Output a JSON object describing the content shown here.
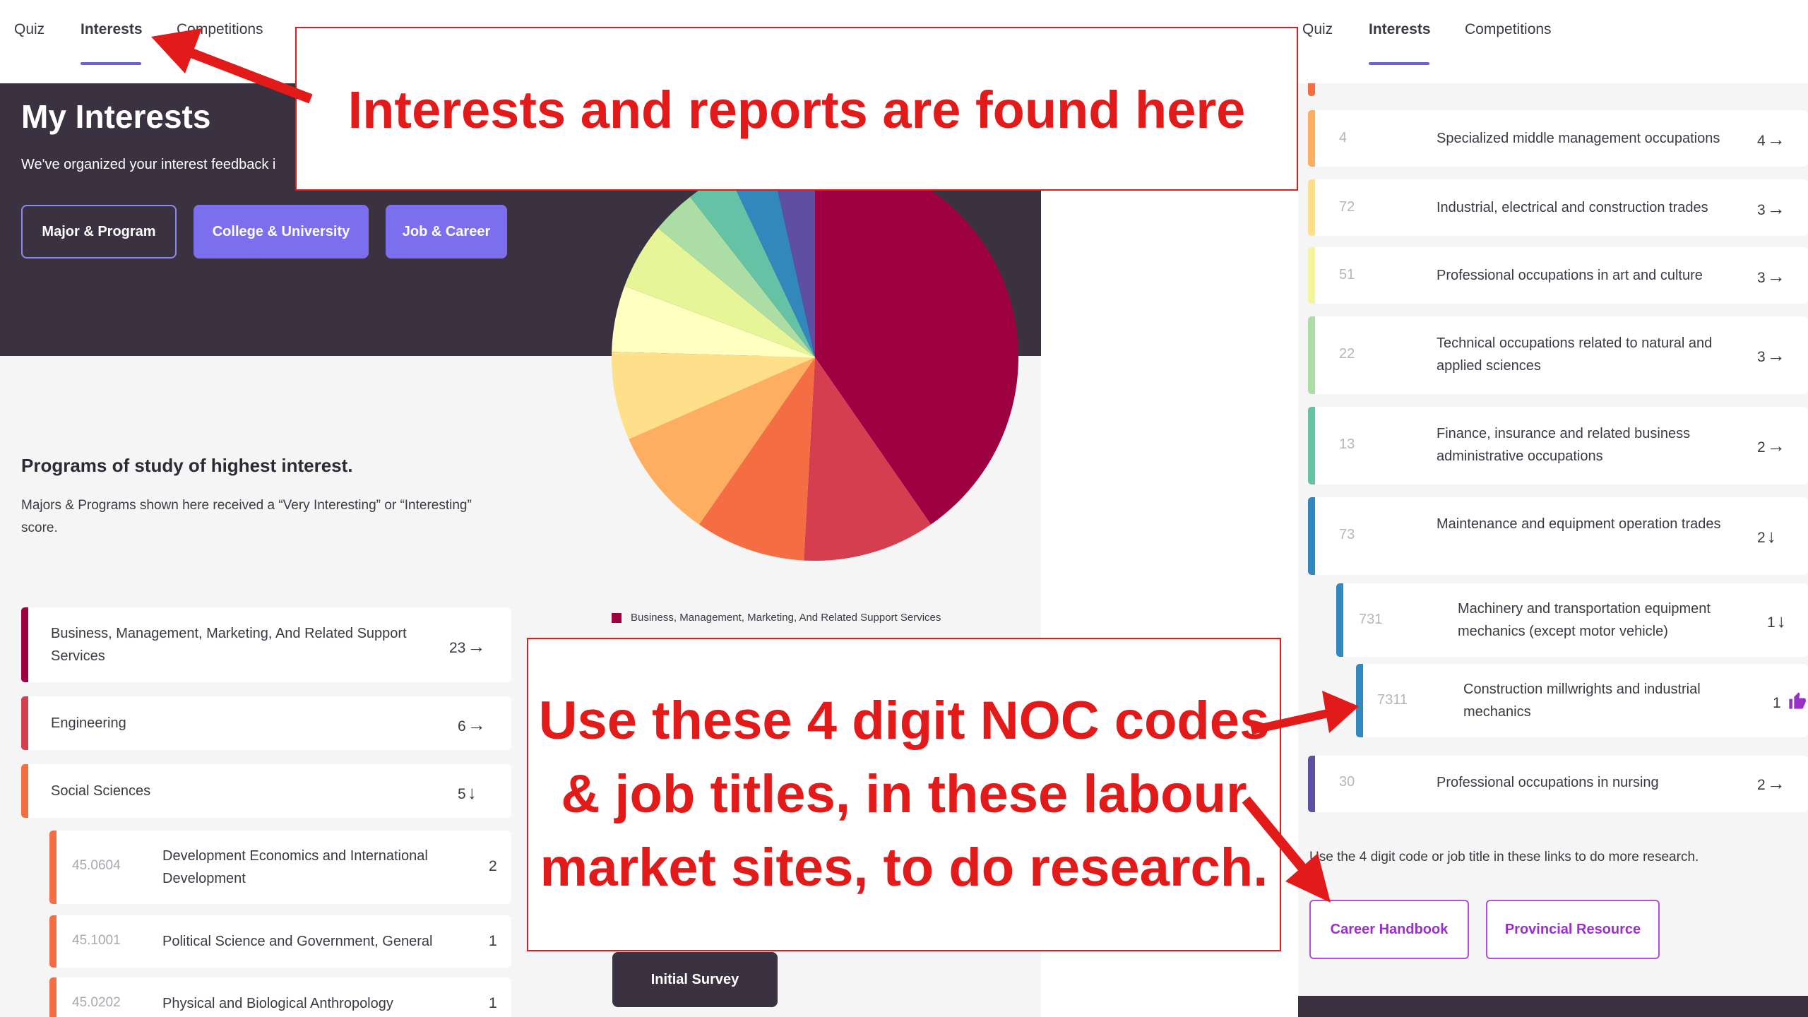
{
  "left": {
    "tabs": [
      "Quiz",
      "Interests",
      "Competitions"
    ],
    "active_tab": "Interests",
    "hero": {
      "title": "My Interests",
      "subtitle": "We've organized your interest feedback i",
      "buttons": [
        "Major & Program",
        "College & University",
        "Job & Career"
      ]
    },
    "section": {
      "title": "Programs of study of highest interest.",
      "description": "Majors & Programs shown here received a “Very Interesting” or “Interesting” score."
    },
    "programs": [
      {
        "label": "Business, Management, Marketing, And Related Support Services",
        "count": "23",
        "arrow": "→",
        "color": "#9e0142"
      },
      {
        "label": "Engineering",
        "count": "6",
        "arrow": "→",
        "color": "#d53e4f"
      },
      {
        "label": "Social Sciences",
        "count": "5",
        "arrow": "↓",
        "color": "#f46d43"
      }
    ],
    "subprograms": [
      {
        "code": "45.0604",
        "label": "Development Economics and International Development",
        "count": "2"
      },
      {
        "code": "45.1001",
        "label": "Political Science and Government, General",
        "count": "1"
      },
      {
        "code": "45.0202",
        "label": "Physical and Biological Anthropology",
        "count": "1"
      }
    ],
    "legend_label": "Business, Management, Marketing, And Related Support Services",
    "survey_button": "Initial Survey"
  },
  "chart_data": {
    "type": "pie",
    "values": [
      23,
      6,
      5,
      5,
      4,
      3,
      3,
      2,
      2,
      2,
      2
    ],
    "colors": [
      "#9e0142",
      "#d53e4f",
      "#f46d43",
      "#fdae61",
      "#fee08b",
      "#ffffbf",
      "#e6f598",
      "#abdda4",
      "#66c2a5",
      "#3288bd",
      "#5e4fa2"
    ],
    "legend": [
      "Business, Management, Marketing, And Related Support Services"
    ]
  },
  "right": {
    "tabs": [
      "Quiz",
      "Interests",
      "Competitions"
    ],
    "active_tab": "Interests",
    "items": [
      {
        "code": "4",
        "label": "Specialized middle management occupations",
        "count": "4",
        "arrow": "→",
        "color": "#fdae61"
      },
      {
        "code": "72",
        "label": "Industrial, electrical and construction trades",
        "count": "3",
        "arrow": "→",
        "color": "#fee08b"
      },
      {
        "code": "51",
        "label": "Professional occupations in art and culture",
        "count": "3",
        "arrow": "→",
        "color": "#ffffbf"
      },
      {
        "code": "22",
        "label": "Technical occupations related to natural and applied sciences",
        "count": "3",
        "arrow": "→",
        "color": "#abdda4"
      },
      {
        "code": "13",
        "label": "Finance, insurance and related business administrative occupations",
        "count": "2",
        "arrow": "→",
        "color": "#66c2a5"
      },
      {
        "code": "73",
        "label": "Maintenance and equipment operation trades",
        "count": "2",
        "arrow": "↓",
        "color": "#3288bd"
      },
      {
        "code": "731",
        "label": "Machinery and transportation equipment mechanics (except motor vehicle)",
        "count": "1",
        "arrow": "↓",
        "color": "#3288bd"
      },
      {
        "code": "7311",
        "label": "Construction millwrights and industrial mechanics",
        "count": "1",
        "arrow": "thumbs-up-icon",
        "color": "#3288bd"
      },
      {
        "code": "30",
        "label": "Professional occupations in nursing",
        "count": "2",
        "arrow": "→",
        "color": "#5e4fa2"
      }
    ],
    "note": "Use the 4 digit code or job title in these links to do more research.",
    "links": [
      "Career Handbook",
      "Provincial Resource"
    ]
  },
  "annotations": {
    "top": "Interests and reports are found here",
    "bottom": "Use these 4 digit NOC codes & job titles, in these labour market sites, to do research."
  }
}
